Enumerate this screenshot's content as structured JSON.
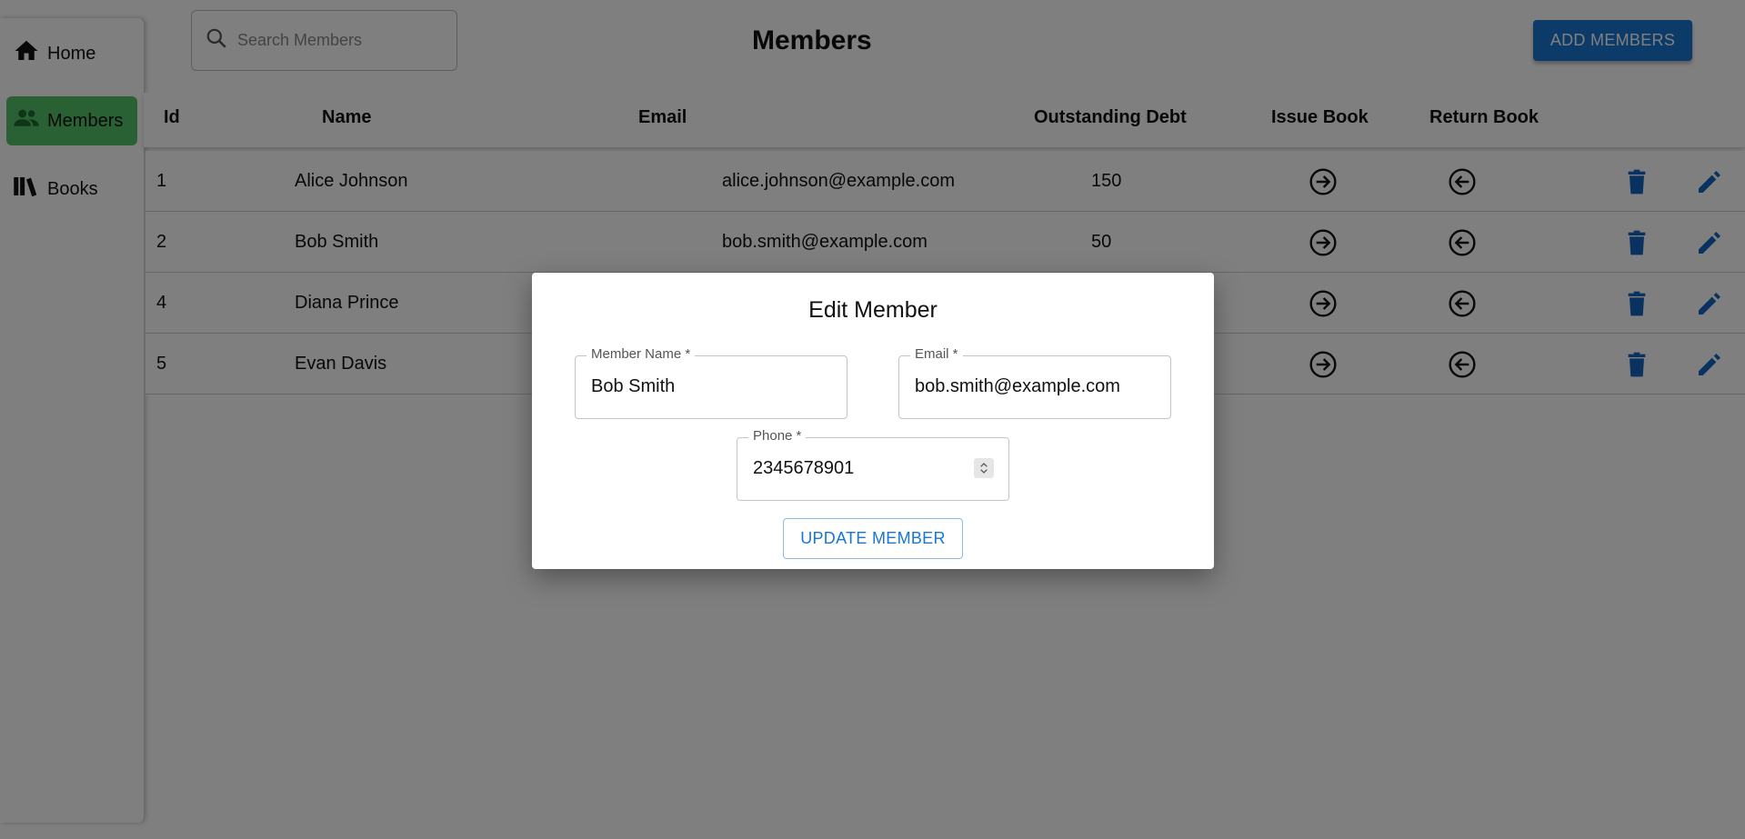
{
  "sidebar": {
    "items": [
      {
        "label": "Home",
        "icon": "home-icon"
      },
      {
        "label": "Members",
        "icon": "users-icon",
        "active": true
      },
      {
        "label": "Books",
        "icon": "books-icon"
      }
    ]
  },
  "header": {
    "search_placeholder": "Search Members",
    "title": "Members",
    "add_button_label": "ADD MEMBERS"
  },
  "table": {
    "columns": [
      "Id",
      "Name",
      "Email",
      "Outstanding Debt",
      "Issue Book",
      "Return Book"
    ],
    "rows": [
      {
        "id": "1",
        "name": "Alice Johnson",
        "email": "alice.johnson@example.com",
        "debt": "150"
      },
      {
        "id": "2",
        "name": "Bob Smith",
        "email": "bob.smith@example.com",
        "debt": "50"
      },
      {
        "id": "4",
        "name": "Diana Prince",
        "email": "",
        "debt": ""
      },
      {
        "id": "5",
        "name": "Evan Davis",
        "email": "",
        "debt": ""
      }
    ]
  },
  "modal": {
    "title": "Edit Member",
    "name_label": "Member Name *",
    "name_value": "Bob Smith",
    "email_label": "Email *",
    "email_value": "bob.smith@example.com",
    "phone_label": "Phone *",
    "phone_value": "2345678901",
    "submit_label": "UPDATE MEMBER"
  },
  "colors": {
    "accent": "#1976d2",
    "active_nav": "#52c268",
    "overlay": "rgba(0,0,0,0.5)"
  }
}
